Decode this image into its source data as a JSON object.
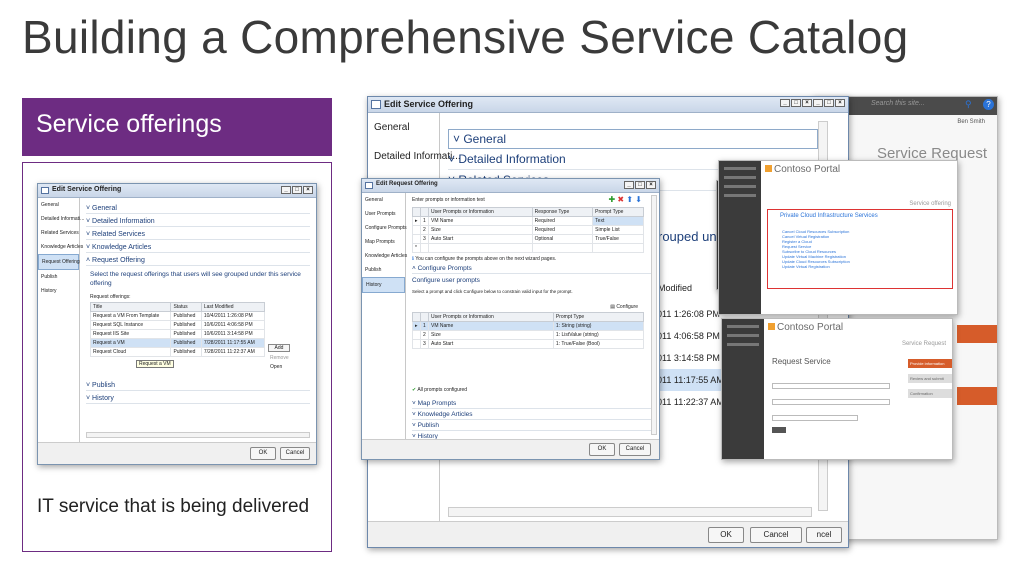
{
  "slide": {
    "title": "Building a Comprehensive Service Catalog",
    "section_label": "Service offerings",
    "caption": "IT service that is being delivered"
  },
  "small_dialog": {
    "title": "Edit Service Offering",
    "nav": [
      "General",
      "Detailed Informati...",
      "Related Services",
      "Knowledge Articles",
      "Request Offering",
      "Publish",
      "History"
    ],
    "selected_nav": 4,
    "sections": [
      "General",
      "Detailed Information",
      "Related Services",
      "Knowledge Articles",
      "Request Offering"
    ],
    "description": "Select the request offerings that users will see grouped under this service offering",
    "list_label": "Request offerings:",
    "columns": [
      "Title",
      "Status",
      "Last Modified"
    ],
    "rows": [
      [
        "Request a VM From Template",
        "Published",
        "10/4/2011 1:26:08 PM"
      ],
      [
        "Request SQL Instance",
        "Published",
        "10/6/2011 4:06:58 PM"
      ],
      [
        "Request IIS Site",
        "Published",
        "10/6/2011 3:14:58 PM"
      ],
      [
        "Request a VM",
        "Published",
        "7/28/2011 11:17:55 AM"
      ],
      [
        "Request Cloud",
        "Published",
        "7/28/2011 11:22:37 AM"
      ]
    ],
    "tooltip": "Request a VM",
    "side_buttons": [
      "Add",
      "Remove",
      "Open"
    ],
    "bottom_sections": [
      "Publish",
      "History"
    ],
    "ok": "OK",
    "cancel": "Cancel"
  },
  "big_dialog": {
    "title": "Edit Service Offering",
    "nav": [
      "General",
      "Detailed Informati...",
      "Related Services"
    ],
    "sections": [
      "General",
      "Detailed Information",
      "Related Services"
    ],
    "partial_text": "rouped under",
    "partial_header": "Modified",
    "dates": [
      "2011 1:26:08 PM",
      "2011 4:06:58 PM",
      "2011 3:14:58 PM",
      "2011 11:17:55 AM",
      "2011 11:22:37 AM"
    ],
    "ok": "OK",
    "cancel": "Cancel",
    "cancel_partial": "ncel"
  },
  "request_dialog": {
    "title": "Edit Request Offering",
    "nav": [
      "General",
      "User Prompts",
      "Configure Prompts",
      "Map Prompts",
      "Knowledge Articles",
      "Publish",
      "History"
    ],
    "selected_nav": 6,
    "prompt_label": "Enter prompts or information text",
    "prompt_cols": [
      "User Prompts or Information",
      "Response Type",
      "Prompt Type"
    ],
    "prompt_rows": [
      [
        "1",
        "VM Name",
        "Required",
        "Text"
      ],
      [
        "2",
        "Size",
        "Required",
        "Simple List"
      ],
      [
        "3",
        "Auto Start",
        "Optional",
        "True/False"
      ]
    ],
    "info": "You can configure the prompts above on the next wizard pages.",
    "configure_section": "Configure Prompts",
    "configure_heading": "Configure user prompts",
    "configure_text": "Select a prompt and click Configure below to constrain valid input for the prompt.",
    "configure_button": "Configure",
    "config_cols": [
      "User Prompts or Information",
      "Prompt Type"
    ],
    "config_rows": [
      [
        "1",
        "VM Name",
        "1: String (string)"
      ],
      [
        "2",
        "Size",
        "1: ListValue (string)"
      ],
      [
        "3",
        "Auto Start",
        "1: True/False (Bool)"
      ]
    ],
    "status": "All prompts configured",
    "bottom_sections": [
      "Map Prompts",
      "Knowledge Articles",
      "Publish",
      "History"
    ],
    "ok": "OK",
    "cancel": "Cancel"
  },
  "browser": {
    "search_placeholder": "Search this site...",
    "user": "Ben Smith",
    "heading": "Service Request"
  },
  "portal1": {
    "logo": "Contoso Portal",
    "right_label": "Service offering",
    "heading": "Private Cloud Infrastructure Services",
    "items": [
      "Cancel Cloud Resources Subscription",
      "Cancel Virtual Registration",
      "Register a Cloud",
      "Request Service",
      "Subscribe to Cloud Resources",
      "Update Virtual Machine Registration",
      "Update Cloud Resources Subscription",
      "Update Virtual Registration"
    ]
  },
  "portal2": {
    "logo": "Contoso Portal",
    "right_label": "Service Request",
    "heading": "Request Service",
    "steps": [
      "Provide information",
      "Review and submit",
      "Confirmation"
    ]
  }
}
